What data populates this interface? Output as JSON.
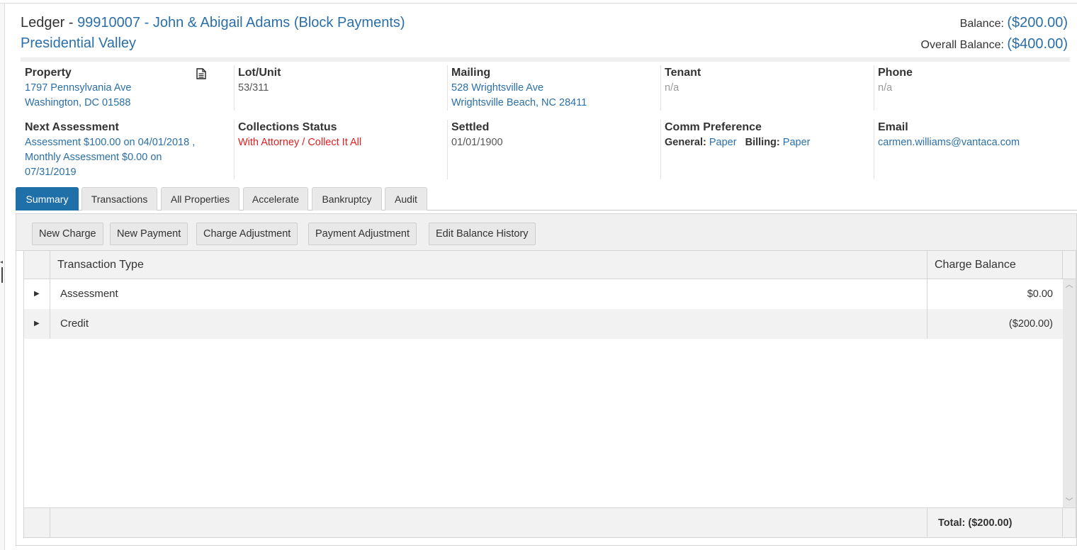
{
  "header": {
    "title_prefix": "Ledger - ",
    "account_title": "99910007 - John & Abigail Adams (Block Payments)",
    "community": "Presidential Valley",
    "balance_label": "Balance: ",
    "balance_value": "($200.00)",
    "overall_label": "Overall Balance: ",
    "overall_value": "($400.00)"
  },
  "info": {
    "property": {
      "label": "Property",
      "line1": "1797 Pennsylvania Ave",
      "line2": "Washington, DC 01588"
    },
    "lot_unit": {
      "label": "Lot/Unit",
      "value": "53/311"
    },
    "mailing": {
      "label": "Mailing",
      "line1": "528 Wrightsville Ave",
      "line2": "Wrightsville Beach, NC 28411"
    },
    "tenant": {
      "label": "Tenant",
      "value": "n/a"
    },
    "phone": {
      "label": "Phone",
      "value": "n/a"
    },
    "next_assessment": {
      "label": "Next Assessment",
      "line1": "Assessment $100.00 on 04/01/2018 ,",
      "line2": "Monthly Assessment $0.00 on",
      "line3": "07/31/2019"
    },
    "collections": {
      "label": "Collections Status",
      "status1": "With Attorney",
      "status2": " / Collect It All"
    },
    "settled": {
      "label": "Settled",
      "value": "01/01/1900"
    },
    "comm": {
      "label": "Comm Preference",
      "general_label": "General:",
      "general_value": "Paper",
      "billing_label": "Billing:",
      "billing_value": "Paper"
    },
    "email": {
      "label": "Email",
      "value": "carmen.williams@vantaca.com"
    }
  },
  "tabs": [
    "Summary",
    "Transactions",
    "All Properties",
    "Accelerate",
    "Bankruptcy",
    "Audit"
  ],
  "toolbar": {
    "new_charge": "New Charge",
    "new_payment": "New Payment",
    "charge_adjustment": "Charge Adjustment",
    "payment_adjustment": "Payment Adjustment",
    "edit_balance_history": "Edit Balance History"
  },
  "grid": {
    "col_type": "Transaction Type",
    "col_balance": "Charge Balance",
    "rows": [
      {
        "type": "Assessment",
        "balance": "$0.00"
      },
      {
        "type": "Credit",
        "balance": "($200.00)"
      }
    ],
    "total": "Total: ($200.00)"
  },
  "colors": {
    "link": "#2a6fa8",
    "accent_tab": "#1f6fa8",
    "alert": "#e02020"
  },
  "icons": [
    "document-icon",
    "expand-arrow-icon",
    "scroll-up-icon",
    "scroll-down-icon",
    "collapse-arrow-icon"
  ]
}
